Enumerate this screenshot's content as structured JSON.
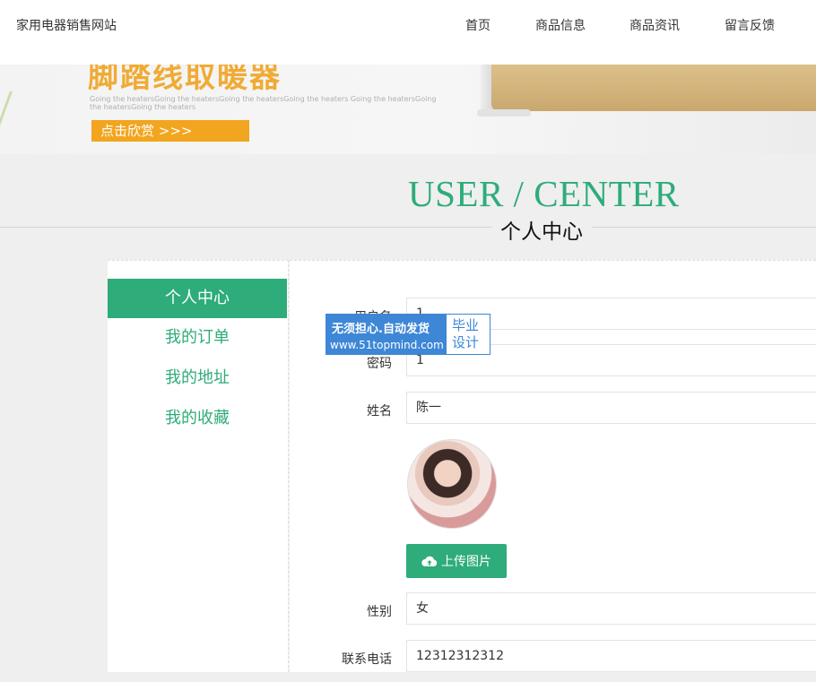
{
  "header": {
    "site_title": "家用电器销售网站",
    "nav": [
      "首页",
      "商品信息",
      "商品资讯",
      "留言反馈"
    ]
  },
  "banner": {
    "heading": "脚踏线取暖器",
    "subtext": "Going the heatersGoing the heatersGoing the heatersGoing the heaters Going the heatersGoing the heatersGoing the heaters",
    "button_label": "点击欣赏  >>>",
    "accent_color": "#f2a51e"
  },
  "section": {
    "title_en": "USER / CENTER",
    "title_cn": "个人中心",
    "accent_color": "#2eac79"
  },
  "sidebar": {
    "items": [
      {
        "label": "个人中心",
        "active": true
      },
      {
        "label": "我的订单",
        "active": false
      },
      {
        "label": "我的地址",
        "active": false
      },
      {
        "label": "我的收藏",
        "active": false
      }
    ]
  },
  "form": {
    "username": {
      "label": "用户名",
      "value": "1"
    },
    "password": {
      "label": "密码",
      "value": "1"
    },
    "name": {
      "label": "姓名",
      "value": "陈一"
    },
    "upload_button": "上传图片",
    "gender": {
      "label": "性别",
      "value": "女"
    },
    "phone": {
      "label": "联系电话",
      "value": "12312312312"
    }
  },
  "watermark": {
    "line1": "无须担心.自动发货",
    "line2": "www.51topmind.com",
    "side": "毕业设计"
  }
}
